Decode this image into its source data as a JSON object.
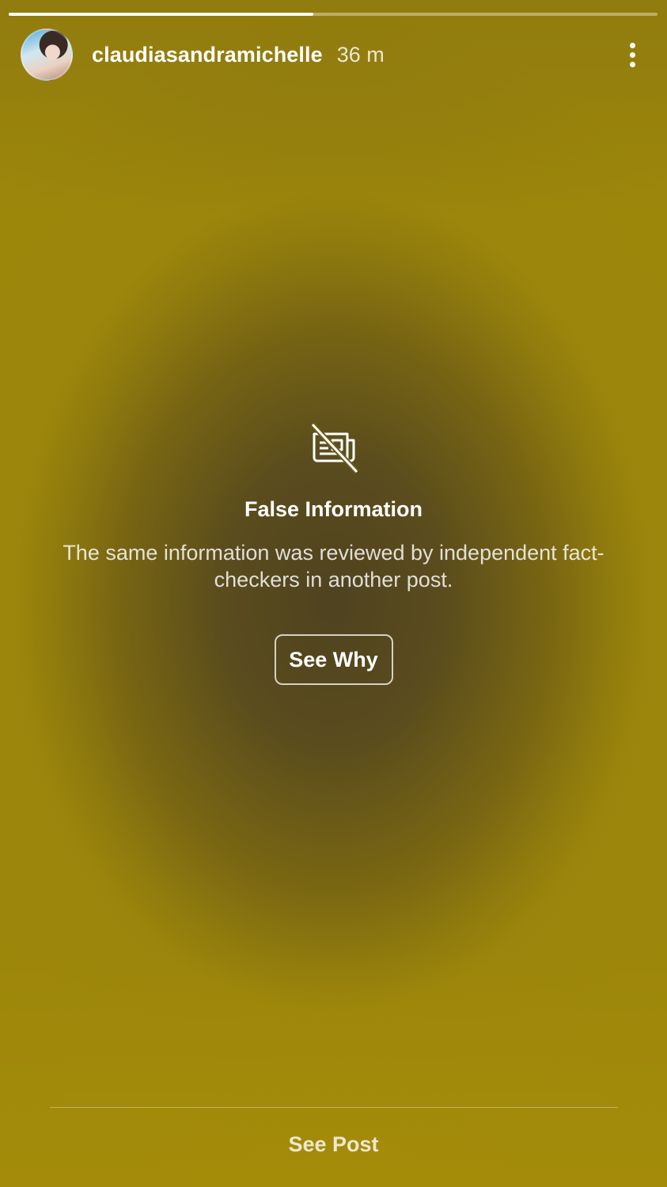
{
  "story": {
    "progress_fraction": 0.47,
    "user": {
      "username": "claudiasandramichelle",
      "time_ago": "36 m"
    }
  },
  "warning": {
    "icon": "no-news-icon",
    "title": "False Information",
    "body": "The same information was reviewed by independent fact-checkers in another post.",
    "button_label": "See Why"
  },
  "footer": {
    "see_post_label": "See Post"
  },
  "colors": {
    "background_center": "#4f4320",
    "background_edge": "#9a840c",
    "text_primary": "#ffffff"
  }
}
